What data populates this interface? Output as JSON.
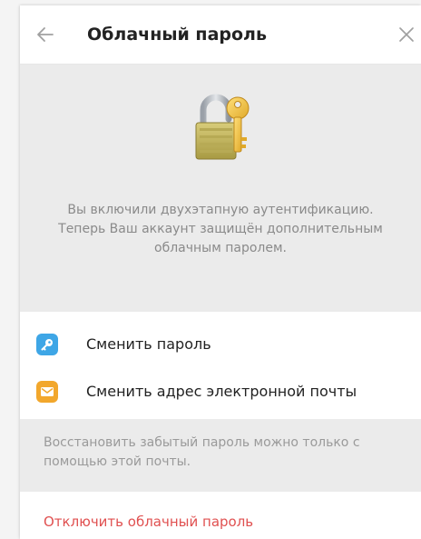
{
  "header": {
    "title": "Облачный пароль",
    "back_icon": "arrow-left-icon",
    "close_icon": "close-icon"
  },
  "hero": {
    "icon": "padlock-key-icon",
    "text": "Вы включили двухэтапную аутентификацию. Теперь Ваш аккаунт защищён дополнительным облачным паролем."
  },
  "menu": {
    "items": [
      {
        "label": "Сменить пароль",
        "icon": "key-icon",
        "color": "#3ea6e6"
      },
      {
        "label": "Сменить адрес электронной почты",
        "icon": "envelope-icon",
        "color": "#f2a72c"
      }
    ]
  },
  "hint": {
    "text": "Восстановить забытый пароль можно только с помощью этой почты."
  },
  "disable": {
    "label": "Отключить облачный пароль",
    "color": "#e05050"
  }
}
